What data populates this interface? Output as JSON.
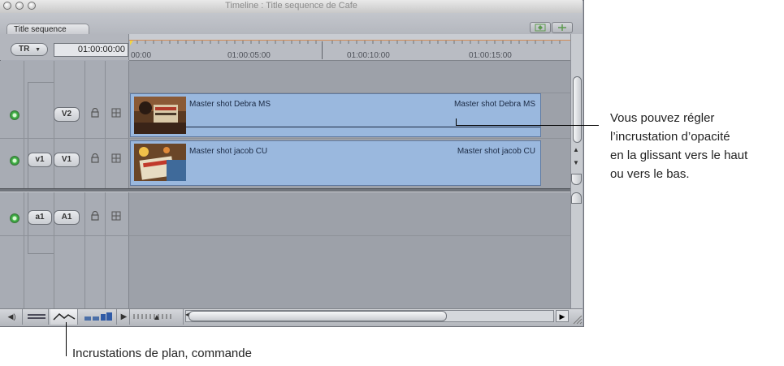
{
  "window": {
    "title": "Timeline : Title sequence de Cafe",
    "tab_label": "Title sequence"
  },
  "header": {
    "track_menu_label": "TR",
    "timecode": "01:00:00:00"
  },
  "ruler": {
    "labels": [
      "00:00",
      "01:00:05:00",
      "01:00:10:00",
      "01:00:15:00"
    ]
  },
  "tracks": {
    "v2": {
      "target_label": "",
      "track_label": "V2",
      "clip": {
        "name_start": "Master shot Debra MS",
        "name_end": "Master shot Debra MS"
      }
    },
    "v1": {
      "target_label": "v1",
      "track_label": "V1",
      "clip": {
        "name_start": "Master shot jacob CU",
        "name_end": "Master shot jacob CU"
      }
    },
    "a1": {
      "target_label": "a1",
      "track_label": "A1"
    }
  },
  "annotations": {
    "right": [
      "Vous pouvez régler",
      "l’incrustation d’opacité",
      "en la glissant vers le haut",
      "ou vers le bas."
    ],
    "bottom": "Incrustations de plan, commande"
  },
  "colors": {
    "clip_fill": "#9ab8de",
    "track_bg": "#9da1a9",
    "enable_green": "#45b64a"
  }
}
